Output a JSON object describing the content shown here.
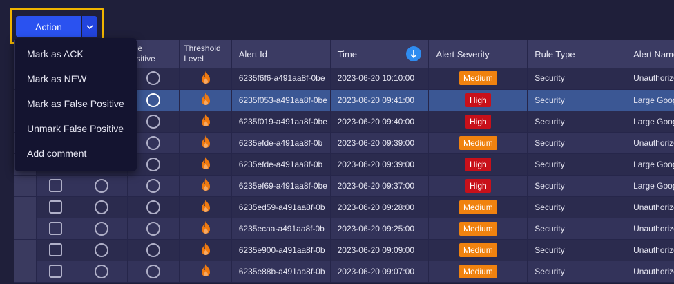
{
  "toolbar": {
    "action_label": "Action"
  },
  "menu": {
    "items": [
      {
        "label": "Mark as ACK"
      },
      {
        "label": "Mark as NEW"
      },
      {
        "label": "Mark as False Positive"
      },
      {
        "label": "Unmark False Positive"
      },
      {
        "label": "Add comment"
      }
    ]
  },
  "table": {
    "headers": {
      "false_positive": "False Positive",
      "false_positive_visible": "lse\nositive",
      "threshold_level": "Threshold Level",
      "alert_id": "Alert Id",
      "time": "Time",
      "alert_severity": "Alert Severity",
      "rule_type": "Rule Type",
      "alert_name": "Alert Name"
    },
    "sort": {
      "column": "time",
      "direction": "descending",
      "icon": "arrow-down-icon"
    },
    "rows": [
      {
        "alert_id": "6235f6f6-a491aa8f-0be",
        "time": "2023-06-20 10:10:00",
        "severity": "Medium",
        "rule_type": "Security",
        "alert_name": "Unauthorized L",
        "selected": false
      },
      {
        "alert_id": "6235f053-a491aa8f-0be",
        "time": "2023-06-20 09:41:00",
        "severity": "High",
        "rule_type": "Security",
        "alert_name": "Large Google D",
        "selected": true
      },
      {
        "alert_id": "6235f019-a491aa8f-0be",
        "time": "2023-06-20 09:40:00",
        "severity": "High",
        "rule_type": "Security",
        "alert_name": "Large Google D",
        "selected": false
      },
      {
        "alert_id": "6235efde-a491aa8f-0b",
        "time": "2023-06-20 09:39:00",
        "severity": "Medium",
        "rule_type": "Security",
        "alert_name": "Unauthorized L",
        "selected": false
      },
      {
        "alert_id": "6235efde-a491aa8f-0b",
        "time": "2023-06-20 09:39:00",
        "severity": "High",
        "rule_type": "Security",
        "alert_name": "Large Google D",
        "selected": false
      },
      {
        "alert_id": "6235ef69-a491aa8f-0be",
        "time": "2023-06-20 09:37:00",
        "severity": "High",
        "rule_type": "Security",
        "alert_name": "Large Google D",
        "selected": false
      },
      {
        "alert_id": "6235ed59-a491aa8f-0b",
        "time": "2023-06-20 09:28:00",
        "severity": "Medium",
        "rule_type": "Security",
        "alert_name": "Unauthorized L",
        "selected": false
      },
      {
        "alert_id": "6235ecaa-a491aa8f-0b",
        "time": "2023-06-20 09:25:00",
        "severity": "Medium",
        "rule_type": "Security",
        "alert_name": "Unauthorized L",
        "selected": false
      },
      {
        "alert_id": "6235e900-a491aa8f-0b",
        "time": "2023-06-20 09:09:00",
        "severity": "Medium",
        "rule_type": "Security",
        "alert_name": "Unauthorized L",
        "selected": false
      },
      {
        "alert_id": "6235e88b-a491aa8f-0b",
        "time": "2023-06-20 09:07:00",
        "severity": "Medium",
        "rule_type": "Security",
        "alert_name": "Unauthorized L",
        "selected": false
      }
    ]
  },
  "colors": {
    "accent": "#2a52f0",
    "highlight_border": "#f0b400",
    "severity_medium": "#f0820f",
    "severity_high": "#c8101a",
    "flame": "#f07a10",
    "selected_row": "#3b5794"
  },
  "icons": {
    "caret": "chevron-down-icon",
    "threshold": "flame-icon",
    "sort": "arrow-down-icon"
  }
}
